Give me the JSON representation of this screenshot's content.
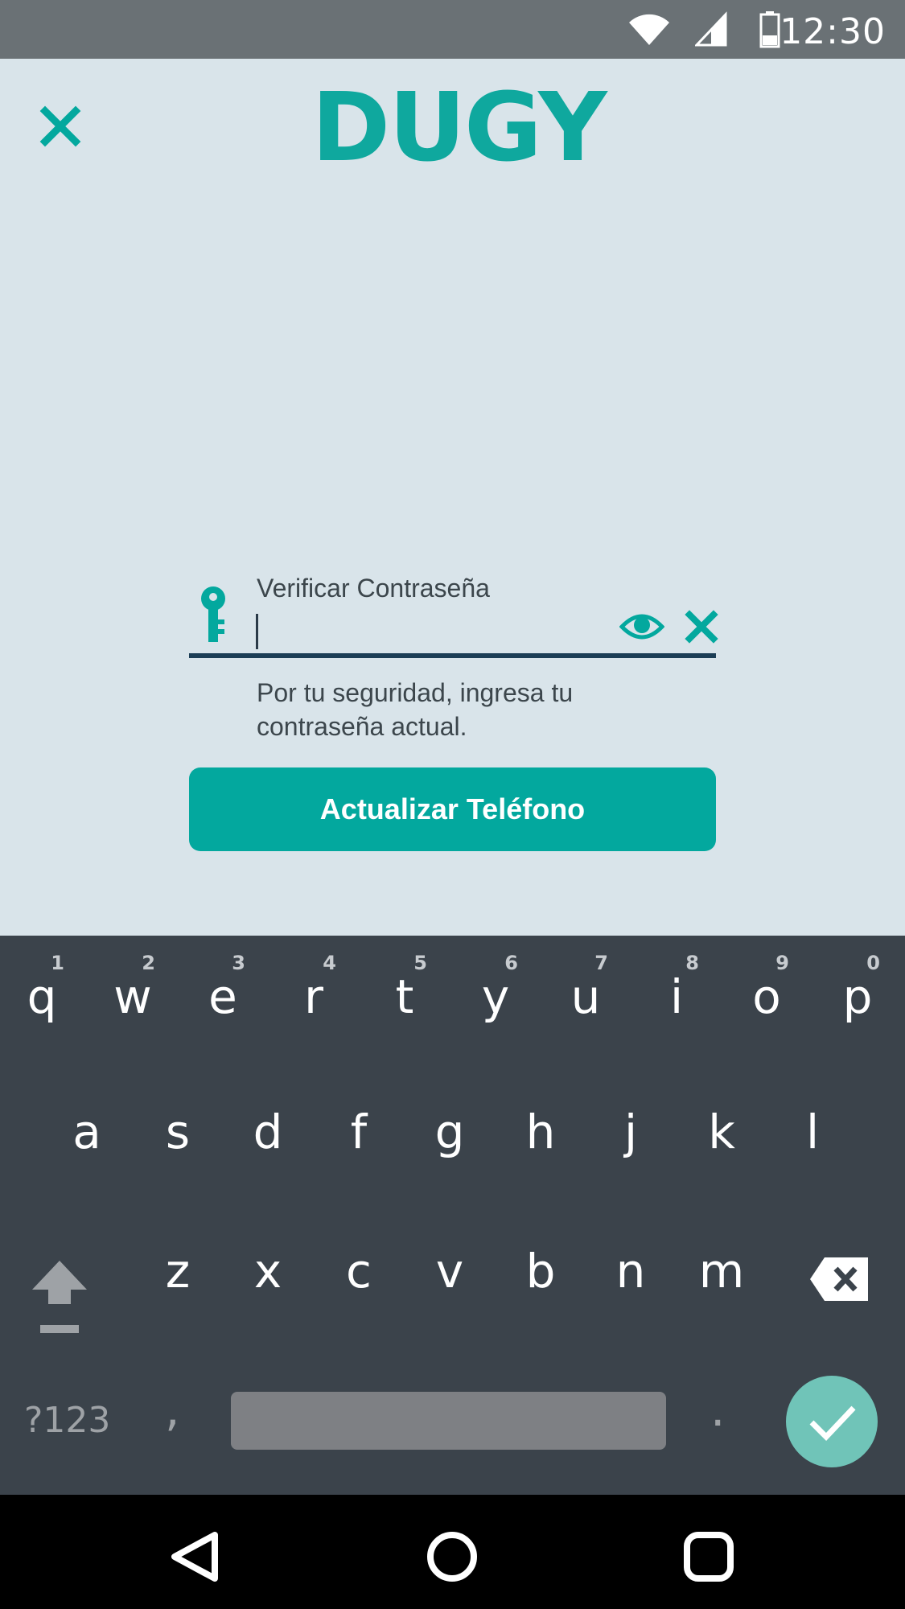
{
  "status_bar": {
    "time": "12:30"
  },
  "app": {
    "logo_text": "DUGY"
  },
  "password_field": {
    "label": "Verificar Contraseña",
    "value": "",
    "helper": "Por tu seguridad, ingresa tu contraseña actual."
  },
  "submit": {
    "label": "Actualizar Teléfono"
  },
  "keyboard": {
    "row1": [
      {
        "ch": "q",
        "hint": "1"
      },
      {
        "ch": "w",
        "hint": "2"
      },
      {
        "ch": "e",
        "hint": "3"
      },
      {
        "ch": "r",
        "hint": "4"
      },
      {
        "ch": "t",
        "hint": "5"
      },
      {
        "ch": "y",
        "hint": "6"
      },
      {
        "ch": "u",
        "hint": "7"
      },
      {
        "ch": "i",
        "hint": "8"
      },
      {
        "ch": "o",
        "hint": "9"
      },
      {
        "ch": "p",
        "hint": "0"
      }
    ],
    "row2": [
      "a",
      "s",
      "d",
      "f",
      "g",
      "h",
      "j",
      "k",
      "l"
    ],
    "row3": [
      "z",
      "x",
      "c",
      "v",
      "b",
      "n",
      "m"
    ],
    "symbols_label": "?123",
    "comma": ",",
    "period": "."
  },
  "colors": {
    "accent": "#03a89e",
    "background": "#d9e4ea",
    "keyboard": "#3b434b",
    "underline": "#1b3d55"
  }
}
